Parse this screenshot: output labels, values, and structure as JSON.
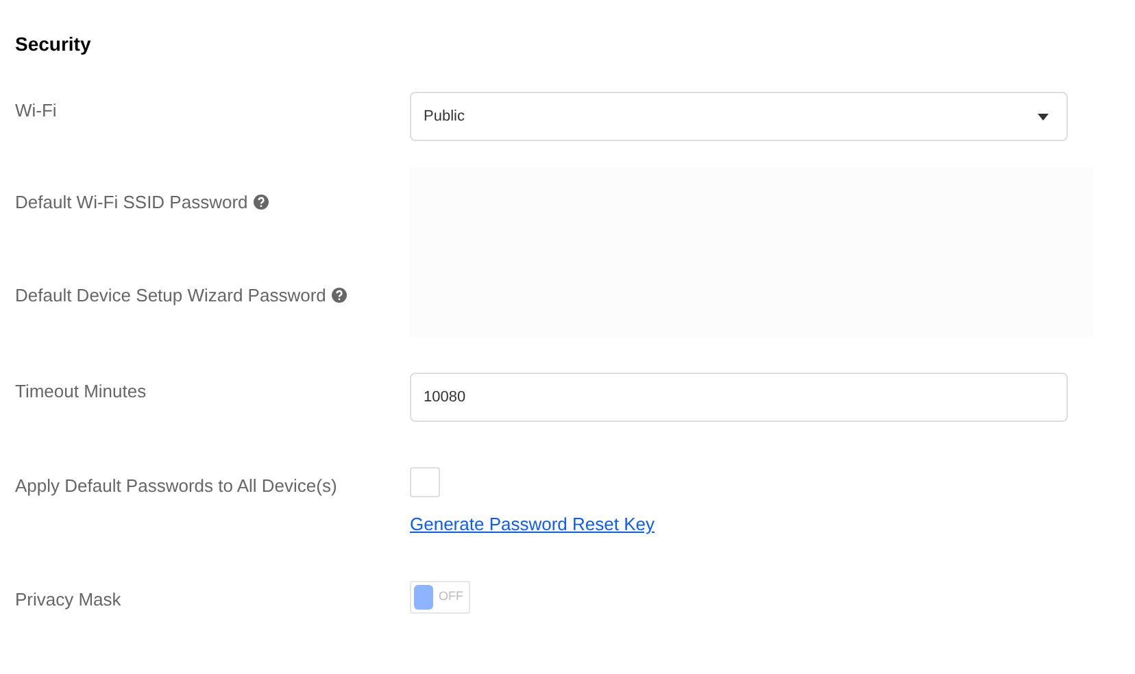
{
  "section_title": "Security",
  "fields": [
    {
      "kind": "select",
      "label": "Wi-Fi",
      "value": "Public"
    },
    {
      "kind": "hidden",
      "label": "Default Wi-Fi SSID Password",
      "help": true
    },
    {
      "kind": "hidden",
      "label": "Default Device Setup Wizard Password",
      "help": true
    },
    {
      "kind": "text",
      "label": "Timeout Minutes",
      "value": "10080"
    },
    {
      "kind": "checkbox",
      "label": "Apply Default Passwords to All Device(s)",
      "checked": false,
      "link": "Generate Password Reset Key"
    },
    {
      "kind": "toggle",
      "label": "Privacy Mask",
      "on": false,
      "state_text": "OFF"
    }
  ]
}
